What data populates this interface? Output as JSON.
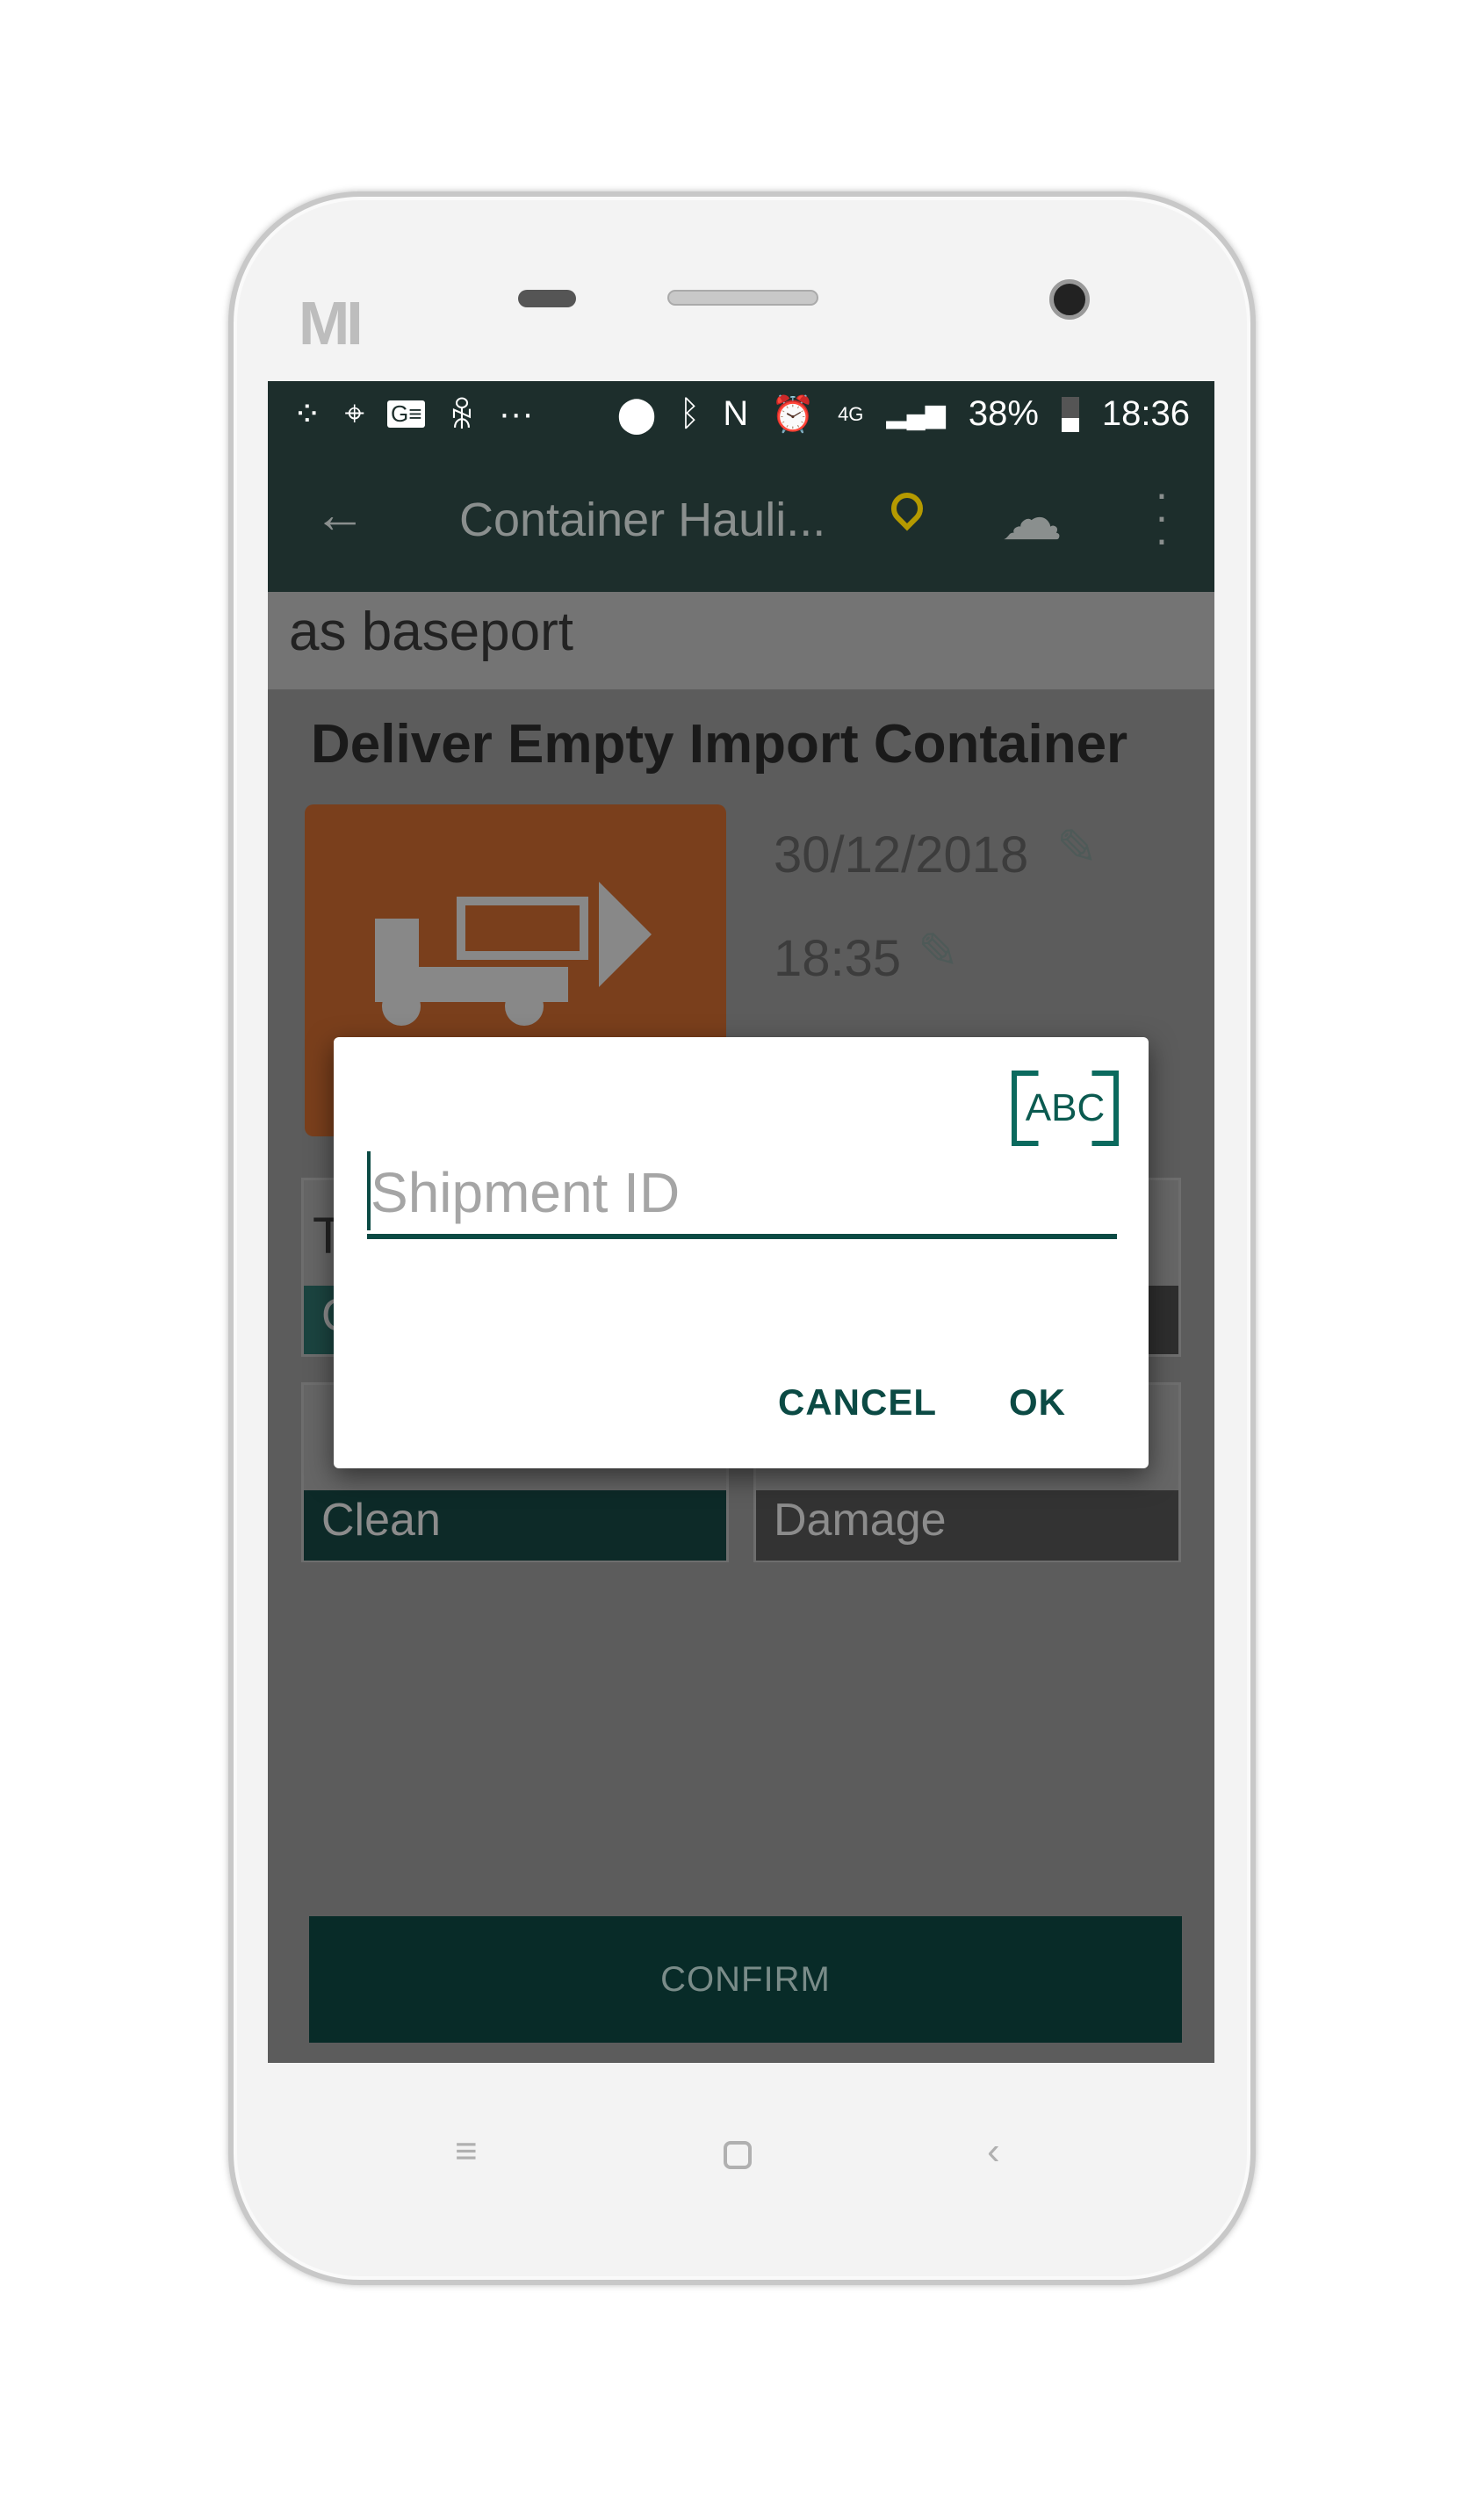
{
  "device": {
    "brand_logo": "MI"
  },
  "status_bar": {
    "battery": "38%",
    "time": "18:36",
    "network": "4G",
    "icons": [
      "fitbit-icon",
      "maps-icon",
      "gmail-news-icon",
      "ok-icon",
      "more-dots-icon",
      "location-icon",
      "bluetooth-icon",
      "nfc-icon",
      "alarm-icon",
      "signal-icon",
      "battery-icon"
    ]
  },
  "toolbar": {
    "title": "Container Hauli...",
    "icons": [
      "back-arrow-icon",
      "location-clock-icon",
      "cloud-check-icon",
      "overflow-menu-icon"
    ],
    "pin_color": "#b59a00"
  },
  "subheader": {
    "text": "as baseport"
  },
  "task": {
    "title": "Deliver Empty Import Container",
    "date": "30/12/2018",
    "time": "18:35",
    "tile_color": "#c9662e"
  },
  "cards": {
    "partial_left_top": "T",
    "partial_left_strip": "C",
    "clean": "Clean",
    "damage": "Damage"
  },
  "dialog": {
    "scan_label": "ABC",
    "input_placeholder": "Shipment ID",
    "input_value": "",
    "cancel": "CANCEL",
    "ok": "OK",
    "accent": "#0b4a44"
  },
  "confirm": {
    "label": "CONFIRM"
  },
  "nav_bar": {
    "icons": [
      "menu-icon",
      "home-icon",
      "back-icon"
    ]
  }
}
